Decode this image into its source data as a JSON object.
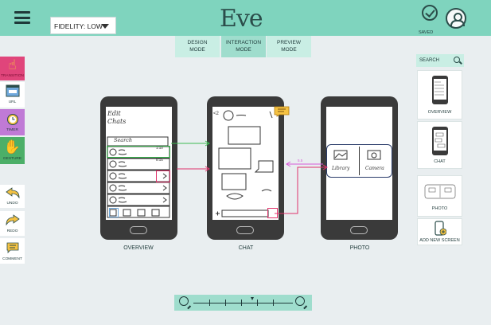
{
  "app": {
    "logo": "Eve"
  },
  "header": {
    "fidelity_label": "FIDELITY: LOW",
    "saved_label": "SAVED"
  },
  "modes": [
    {
      "line1": "DESIGN",
      "line2": "MODE",
      "active": false
    },
    {
      "line1": "INTERACTION",
      "line2": "MODE",
      "active": true
    },
    {
      "line1": "PREVIEW",
      "line2": "MODE",
      "active": false
    }
  ],
  "tools": [
    {
      "label": "TRANSITION",
      "icon": "hand-pointer-icon",
      "color": "#e0457b"
    },
    {
      "label": "URL",
      "icon": "browser-window-icon",
      "color": "#6fa8dc"
    },
    {
      "label": "TIMER",
      "icon": "alarm-clock-icon",
      "color": "#c07ad6"
    },
    {
      "label": "GESTURE",
      "icon": "two-hands-icon",
      "color": "#4caf68"
    }
  ],
  "history_tools": [
    {
      "label": "UNDO",
      "icon": "undo-arrow-icon"
    },
    {
      "label": "REDO",
      "icon": "redo-arrow-icon"
    },
    {
      "label": "COMMENT",
      "icon": "comment-icon"
    }
  ],
  "screens": [
    {
      "caption": "OVERVIEW",
      "title_line1": "Edit",
      "title_line2": "Chats",
      "search_text": "Search",
      "rows": [
        {
          "time": "1:10"
        },
        {
          "time": "8:15"
        },
        {
          "time": ""
        },
        {
          "time": ""
        },
        {
          "time": ""
        },
        {
          "time": ""
        }
      ]
    },
    {
      "caption": "CHAT",
      "back_text": "<2"
    },
    {
      "caption": "PHOTO",
      "options": [
        "Library",
        "Camera"
      ]
    }
  ],
  "connector_label": "5.5",
  "right_panel": {
    "search_label": "SEARCH",
    "cards": [
      {
        "label": "OVERVIEW"
      },
      {
        "label": "CHAT"
      },
      {
        "label": "PHOTO"
      },
      {
        "label": "ADD NEW SCREEN"
      }
    ]
  },
  "colors": {
    "accent": "#7fd4be",
    "accent_light": "#c9eee4",
    "link_green": "#3dbb52",
    "link_red": "#e0326b",
    "link_magenta": "#d85ad8"
  }
}
